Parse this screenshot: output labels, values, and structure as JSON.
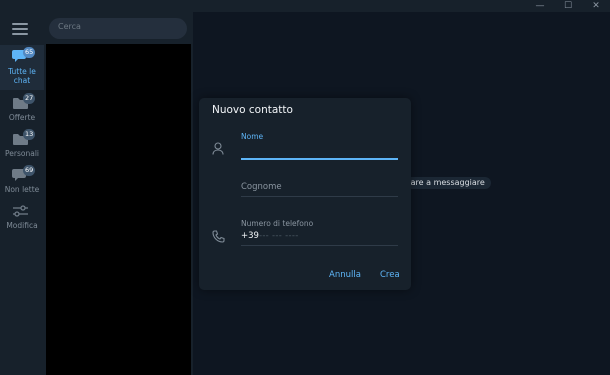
{
  "window": {
    "controls": {
      "minimize": "—",
      "maximize": "☐",
      "close": "✕"
    }
  },
  "search": {
    "placeholder": "Cerca"
  },
  "folders": [
    {
      "label": "Tutte le chat",
      "badge": "65",
      "icon": "chats-icon",
      "active": true
    },
    {
      "label": "Offerte",
      "badge": "27",
      "icon": "folder-icon",
      "active": false
    },
    {
      "label": "Personali",
      "badge": "13",
      "icon": "folder-icon",
      "active": false
    },
    {
      "label": "Non lette",
      "badge": "69",
      "icon": "chats-icon",
      "active": false
    },
    {
      "label": "Modifica",
      "badge": "",
      "icon": "sliders-icon",
      "active": false
    }
  ],
  "main": {
    "hint": "iziare a messaggiare"
  },
  "dialog": {
    "title": "Nuovo contatto",
    "first_name_label": "Nome",
    "last_name_label": "Cognome",
    "phone_label": "Numero di telefono",
    "phone_prefix": "+39",
    "phone_mask": "--- --- ----",
    "cancel_label": "Annulla",
    "create_label": "Crea"
  },
  "colors": {
    "accent": "#5eb5f7",
    "sidebar_bg": "#17212b",
    "main_bg": "#0e1621",
    "badge_active": "#5288c1",
    "badge_muted": "#3e546a"
  }
}
